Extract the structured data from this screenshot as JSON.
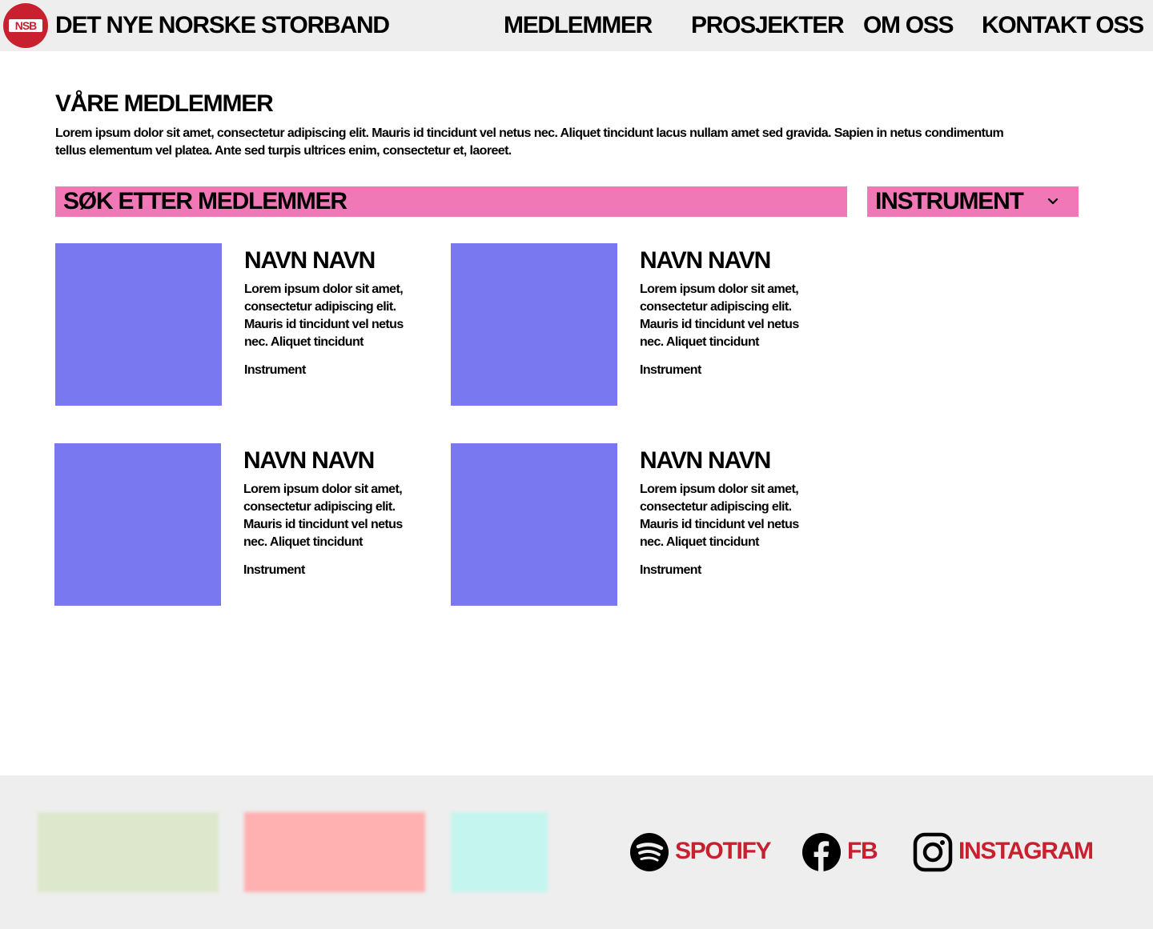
{
  "header": {
    "logo_text": "NSB",
    "brand": "DET NYE NORSKE STORBAND",
    "nav": [
      "MEDLEMMER",
      "PROSJEKTER",
      "OM OSS",
      "KONTAKT OSS"
    ]
  },
  "main": {
    "title": "VÅRE MEDLEMMER",
    "intro": "Lorem ipsum dolor sit amet, consectetur adipiscing elit. Mauris id tincidunt vel netus nec. Aliquet tincidunt lacus nullam amet sed gravida. Sapien in netus condimentum tellus elementum vel platea. Ante sed turpis ultrices enim, consectetur et, laoreet.",
    "search_placeholder": "SØK ETTER MEDLEMMER",
    "filter_label": "INSTRUMENT",
    "members": [
      {
        "name": "NAVN NAVN",
        "desc": "Lorem ipsum dolor sit amet, consectetur adipiscing elit. Mauris id tincidunt vel netus nec. Aliquet tincidunt",
        "instrument": "Instrument"
      },
      {
        "name": "NAVN NAVN",
        "desc": "Lorem ipsum dolor sit amet, consectetur adipiscing elit. Mauris id tincidunt vel netus nec. Aliquet tincidunt",
        "instrument": "Instrument"
      },
      {
        "name": "NAVN NAVN",
        "desc": "Lorem ipsum dolor sit amet, consectetur adipiscing elit. Mauris id tincidunt vel netus nec. Aliquet tincidunt",
        "instrument": "Instrument"
      },
      {
        "name": "NAVN NAVN",
        "desc": "Lorem ipsum dolor sit amet, consectetur adipiscing elit. Mauris id tincidunt vel netus nec. Aliquet tincidunt",
        "instrument": "Instrument"
      }
    ]
  },
  "footer": {
    "social": [
      {
        "label": "SPOTIFY",
        "icon": "spotify-icon"
      },
      {
        "label": "FB",
        "icon": "facebook-icon"
      },
      {
        "label": "INSTAGRAM",
        "icon": "instagram-icon"
      }
    ]
  },
  "colors": {
    "accent_pink": "#f178b6",
    "photo_placeholder": "#7a78f0",
    "brand_red": "#c8202e",
    "header_bg": "#eeeeee",
    "sponsor_green": "#dce7cc",
    "sponsor_pink": "#ffb0b0",
    "sponsor_teal": "#c4f5ee"
  }
}
